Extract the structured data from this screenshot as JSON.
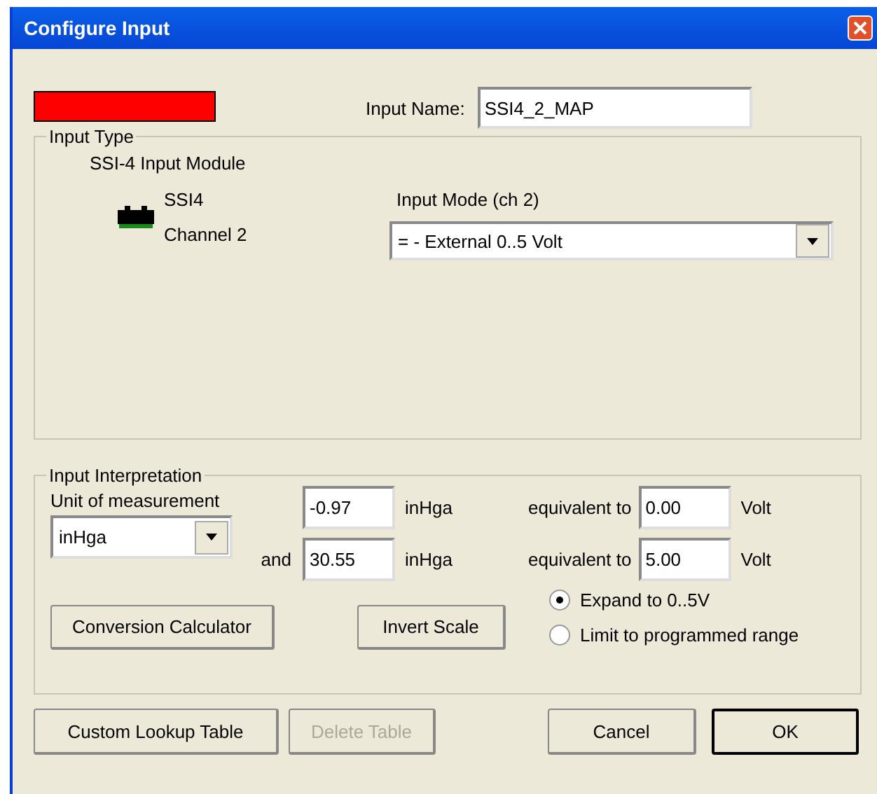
{
  "window": {
    "title": "Configure Input"
  },
  "input_color": {
    "color": "#ff0000"
  },
  "input_name": {
    "label": "Input Name:",
    "value": "SSI4_2_MAP"
  },
  "input_type": {
    "title": "Input Type",
    "module": "SSI-4 Input Module",
    "device": "SSI4",
    "channel": "Channel 2",
    "mode_label": "Input Mode (ch 2)",
    "mode_value": "= - External 0..5 Volt"
  },
  "interpretation": {
    "title": "Input Interpretation",
    "unit_label": "Unit of measurement",
    "unit_value": "inHga",
    "rows": [
      {
        "prefix": "",
        "value": "-0.97",
        "unit": "inHga",
        "equiv_label": "equivalent to",
        "volt_value": "0.00",
        "volt_unit": "Volt"
      },
      {
        "prefix": "and",
        "value": "30.55",
        "unit": "inHga",
        "equiv_label": "equivalent to",
        "volt_value": "5.00",
        "volt_unit": "Volt"
      }
    ],
    "buttons": [
      {
        "label": "Conversion Calculator"
      },
      {
        "label": "Invert Scale"
      }
    ],
    "options": [
      {
        "label": "Expand to 0..5V",
        "selected": true
      },
      {
        "label": "Limit to programmed range",
        "selected": false
      }
    ]
  },
  "footer_buttons": [
    {
      "label": "Custom Lookup Table",
      "disabled": false,
      "default": false
    },
    {
      "label": "Delete Table",
      "disabled": true,
      "default": false
    },
    {
      "label": "Cancel",
      "disabled": false,
      "default": false
    },
    {
      "label": "OK",
      "disabled": false,
      "default": true
    }
  ]
}
